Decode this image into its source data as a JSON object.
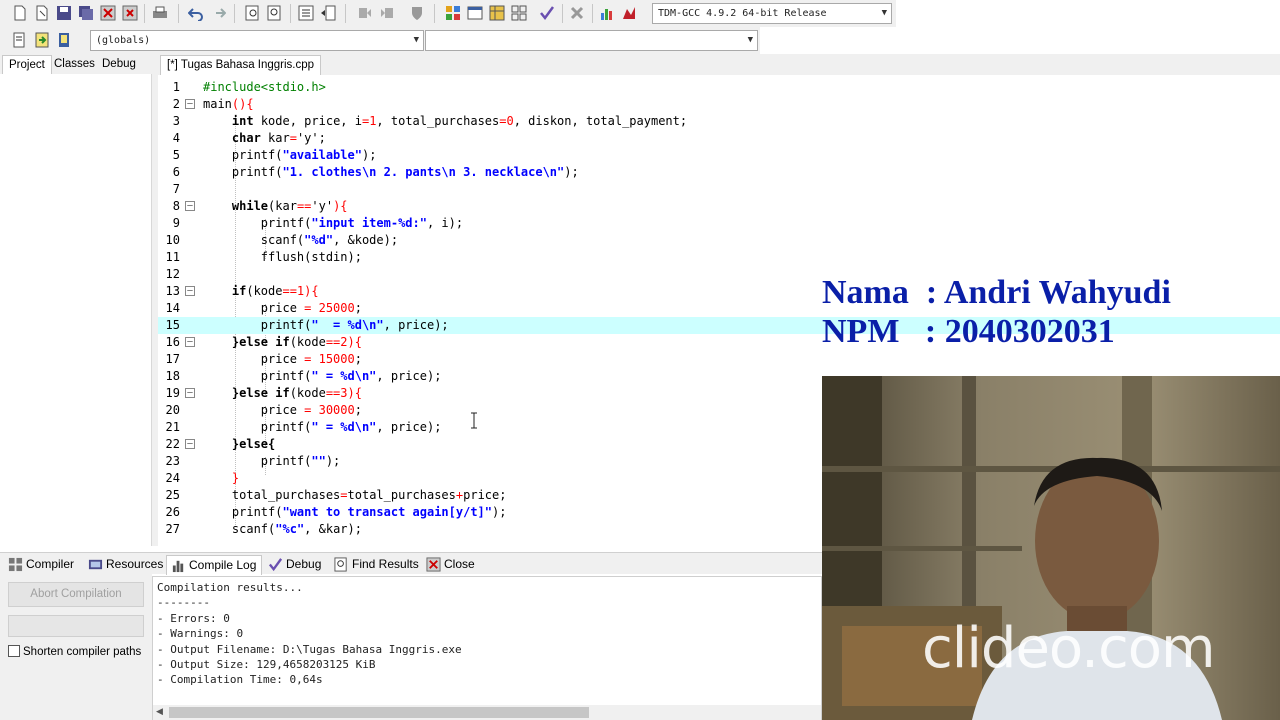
{
  "toolbar": {
    "compiler_select": "TDM-GCC 4.9.2 64-bit Release",
    "scope_select": "(globals)",
    "function_select": ""
  },
  "left_panel": {
    "tabs": [
      "Project",
      "Classes",
      "Debug"
    ]
  },
  "editor": {
    "tab_label": "[*] Tugas Bahasa Inggris.cpp",
    "lines": [
      {
        "n": "1"
      },
      {
        "n": "2"
      },
      {
        "n": "3"
      },
      {
        "n": "4"
      },
      {
        "n": "5"
      },
      {
        "n": "6"
      },
      {
        "n": "7"
      },
      {
        "n": "8"
      },
      {
        "n": "9"
      },
      {
        "n": "10"
      },
      {
        "n": "11"
      },
      {
        "n": "12"
      },
      {
        "n": "13"
      },
      {
        "n": "14"
      },
      {
        "n": "15"
      },
      {
        "n": "16"
      },
      {
        "n": "17"
      },
      {
        "n": "18"
      },
      {
        "n": "19"
      },
      {
        "n": "20"
      },
      {
        "n": "21"
      },
      {
        "n": "22"
      },
      {
        "n": "23"
      },
      {
        "n": "24"
      },
      {
        "n": "25"
      },
      {
        "n": "26"
      },
      {
        "n": "27"
      }
    ],
    "code": {
      "l1": "#include<stdio.h>",
      "l2a": "main",
      "l2b": "(){",
      "l3a": "int",
      "l3b": " kode, price, i",
      "l3c": "=1",
      "l3d": ", total_purchases",
      "l3e": "=0",
      "l3f": ", diskon, total_payment;",
      "l4a": "char",
      "l4b": " kar",
      "l4c": "=",
      "l4d": "'y'",
      "l4e": ";",
      "l5a": "printf(",
      "l5b": "\"available\"",
      "l5c": ");",
      "l6a": "printf(",
      "l6b": "\"1. clothes\\n 2. pants\\n 3. necklace\\n\"",
      "l6c": ");",
      "l8a": "while",
      "l8b": "(kar",
      "l8c": "==",
      "l8d": "'y'",
      "l8e": "){",
      "l9a": "printf(",
      "l9b": "\"input item-%d:\"",
      "l9c": ", i);",
      "l10a": "scanf(",
      "l10b": "\"%d\"",
      "l10c": ", &kode);",
      "l11": "fflush(stdin);",
      "l13a": "if",
      "l13b": "(kode",
      "l13c": "==1",
      "l13d": "){",
      "l14a": "price ",
      "l14b": "= 25000",
      "l14c": ";",
      "l15a": "printf(",
      "l15b": "\"  = %d\\n\"",
      "l15c": ", price);",
      "l16a": "}else if",
      "l16b": "(kode",
      "l16c": "==2",
      "l16d": "){",
      "l17a": "price ",
      "l17b": "= 15000",
      "l17c": ";",
      "l18a": "printf(",
      "l18b": "\" = %d\\n\"",
      "l18c": ", price);",
      "l19a": "}else if",
      "l19b": "(kode",
      "l19c": "==3",
      "l19d": "){",
      "l20a": "price ",
      "l20b": "= 30000",
      "l20c": ";",
      "l21a": "printf(",
      "l21b": "\" = %d\\n\"",
      "l21c": ", price);",
      "l22a": "}else{",
      "l23a": "printf(",
      "l23b": "\"\"",
      "l23c": ");",
      "l24": "}",
      "l25a": "total_purchases",
      "l25b": "=",
      "l25c": "total_purchases",
      "l25d": "+",
      "l25e": "price;",
      "l26a": "printf(",
      "l26b": "\"want to transact again[y/t]\"",
      "l26c": ");",
      "l27a": "scanf(",
      "l27b": "\"%c\"",
      "l27c": ", &kar);"
    }
  },
  "bottom_panel": {
    "tabs": {
      "compiler": "Compiler",
      "resources": "Resources",
      "compile_log": "Compile Log",
      "debug": "Debug",
      "find_results": "Find Results",
      "close": "Close"
    },
    "abort_button": "Abort Compilation",
    "shorten_checkbox": "Shorten compiler paths",
    "log_lines": [
      "Compilation results...",
      "--------",
      "- Errors: 0",
      "- Warnings: 0",
      "- Output Filename: D:\\Tugas Bahasa Inggris.exe",
      "- Output Size: 129,4658203125 KiB",
      "- Compilation Time: 0,64s"
    ]
  },
  "overlay": {
    "name_line": "Nama  : Andri Wahyudi",
    "npm_line": "NPM   : 2040302031",
    "watermark": "clideo.com"
  },
  "colors": {
    "keyword": "#000000",
    "string": "#0000ff",
    "number_operator": "#ff0000",
    "preprocessor": "#008000",
    "current_line": "#ccffff",
    "overlay_text": "#0a1fa8"
  }
}
